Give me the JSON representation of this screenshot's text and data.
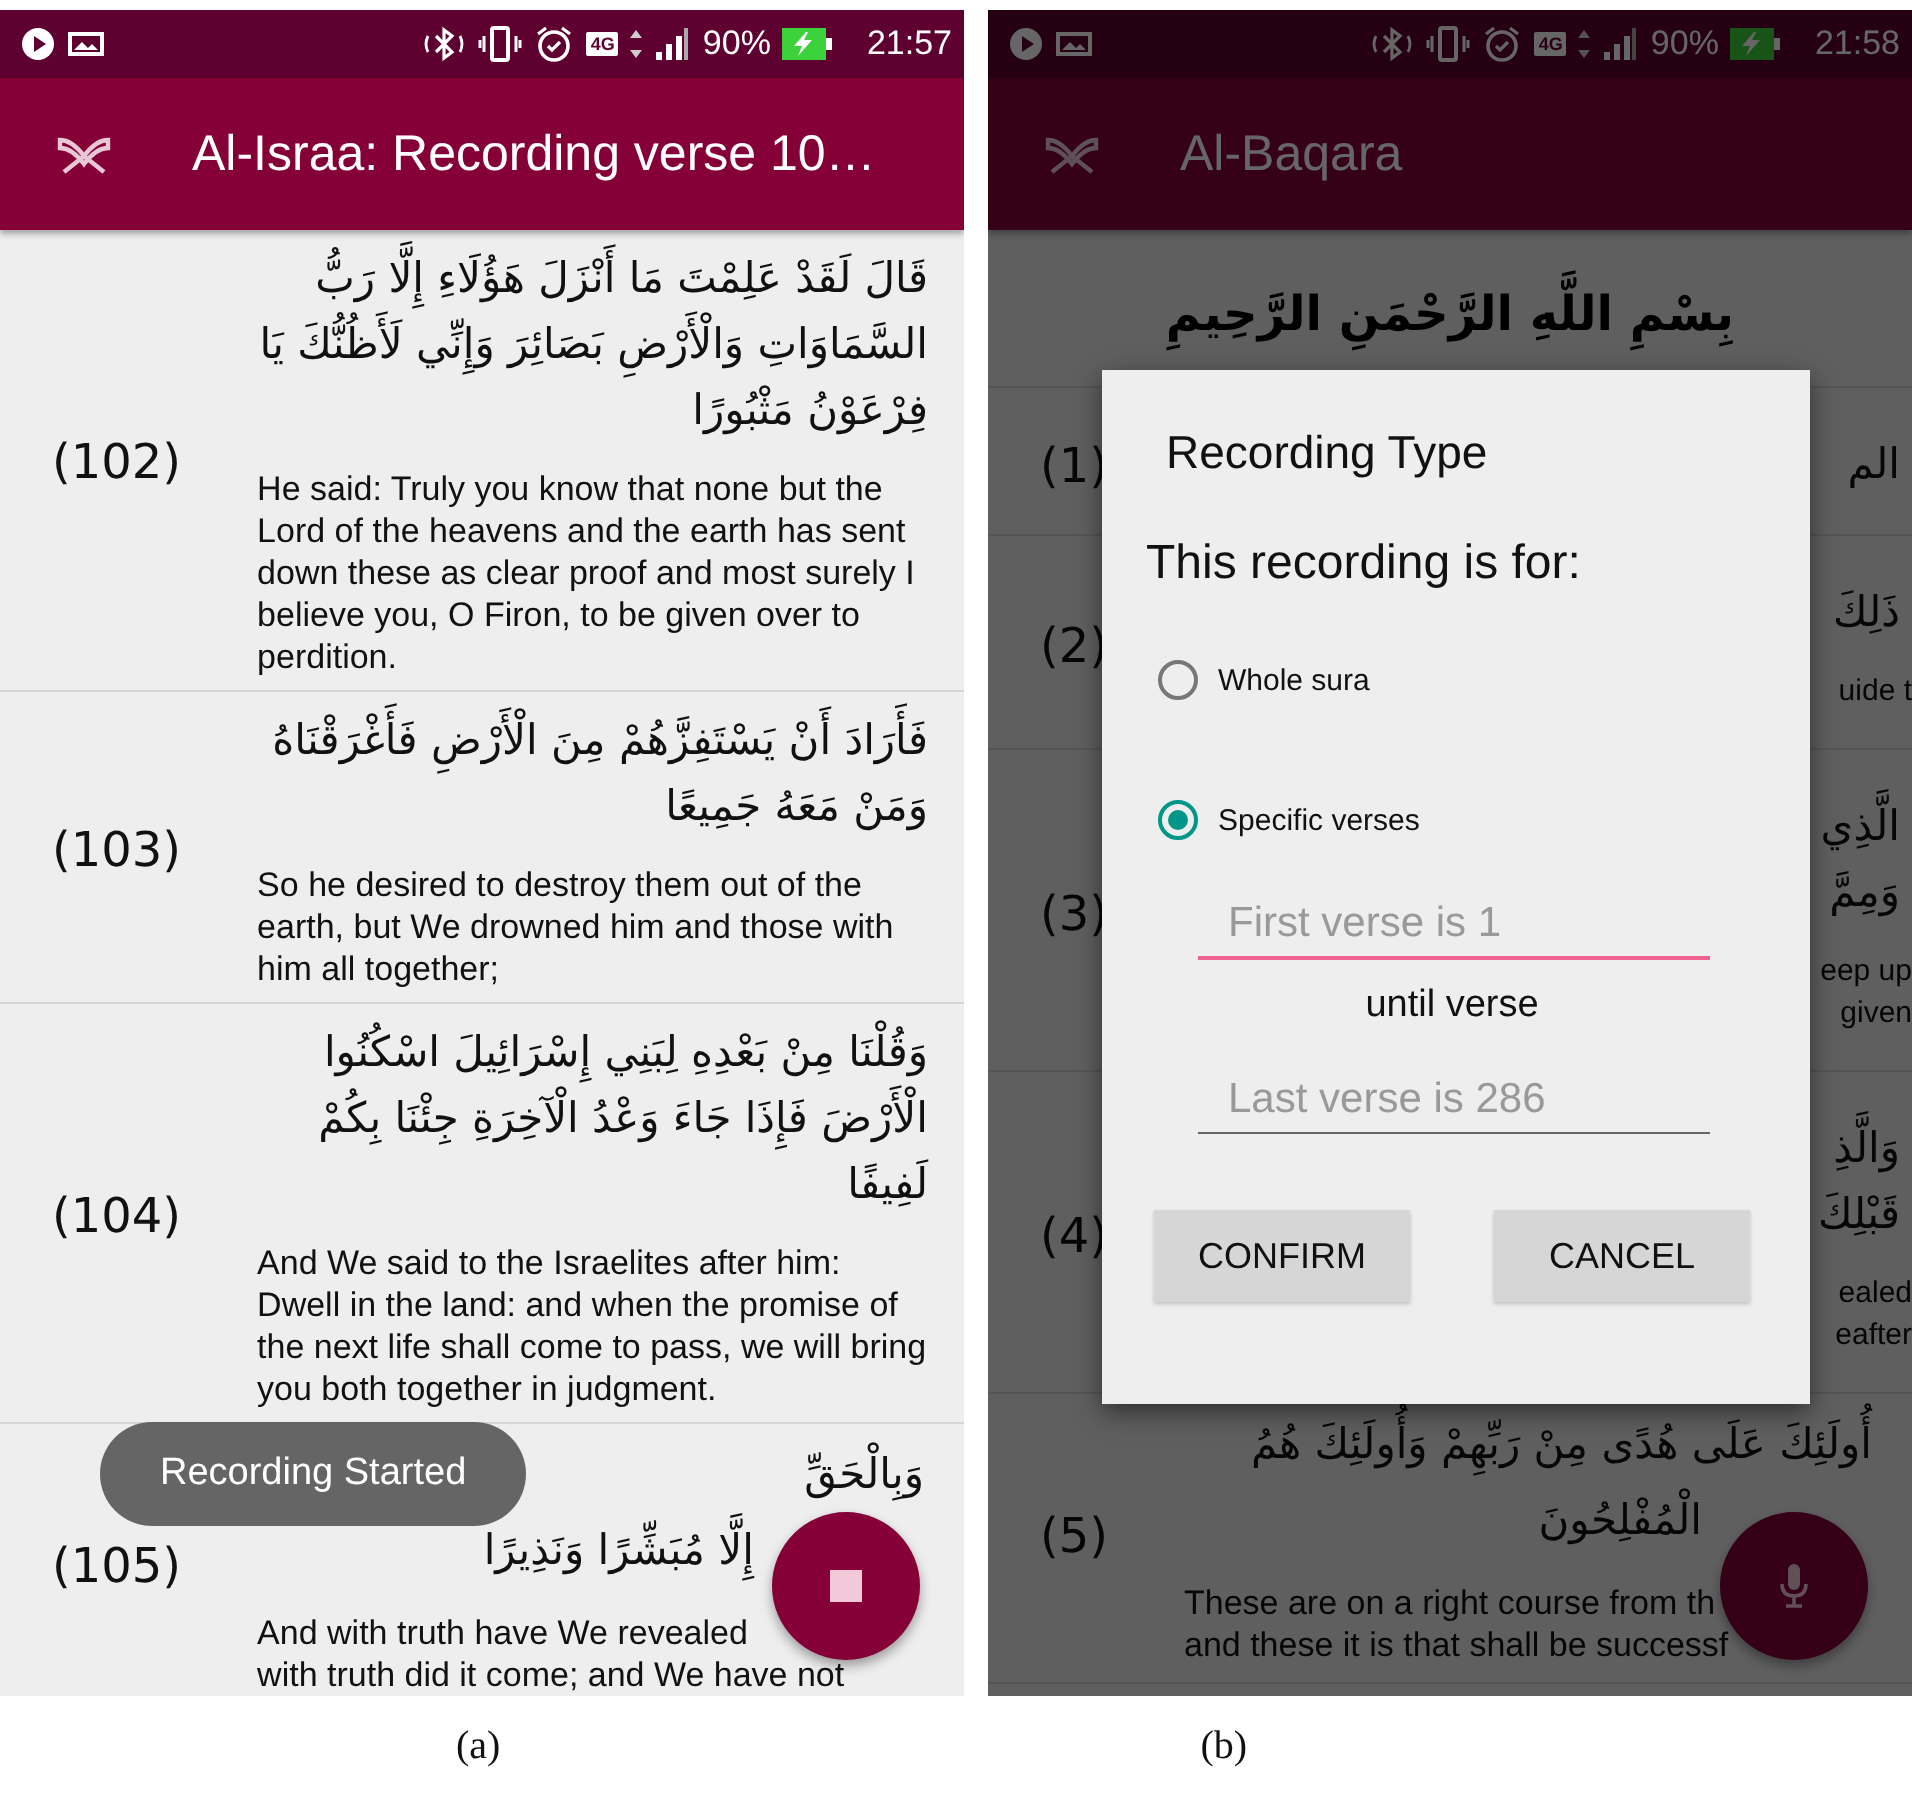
{
  "screens": [
    {
      "status_bar": {
        "network": "4G",
        "battery": "90%",
        "time": "21:57"
      },
      "app_bar": {
        "title": "Al-Israa: Recording verse 10…"
      },
      "verses": [
        {
          "kind": "verse",
          "number": "(102)",
          "arabic": "قَالَ لَقَدْ عَلِمْتَ مَا أَنْزَلَ هَؤُلَاءِ إِلَّا رَبُّ السَّمَاوَاتِ وَالْأَرْضِ بَصَائِرَ وَإِنِّي لَأَظُنُّكَ يَا فِرْعَوْنُ مَثْبُورًا",
          "translation": "He said: Truly you know that none but the Lord of the heavens and the earth has sent down these as clear proof and most surely I believe you, O Firon, to be given over to perdition."
        },
        {
          "kind": "verse",
          "number": "(103)",
          "arabic": "فَأَرَادَ أَنْ يَسْتَفِزَّهُمْ مِنَ الْأَرْضِ فَأَغْرَقْنَاهُ وَمَنْ مَعَهُ جَمِيعًا",
          "translation": "So he desired to destroy them out of the earth, but We drowned him and those with him all together;"
        },
        {
          "kind": "verse",
          "number": "(104)",
          "arabic": "وَقُلْنَا مِنْ بَعْدِهِ لِبَنِي إِسْرَائِيلَ اسْكُنُوا الْأَرْضَ فَإِذَا جَاءَ وَعْدُ الْآخِرَةِ جِئْنَا بِكُمْ لَفِيفًا",
          "translation": "And We said to the Israelites after him: Dwell in the land: and when the promise of the next life shall come to pass, we will bring you both together in judgment."
        },
        {
          "kind": "partial",
          "number": "(105)",
          "arabic": "وَبِالْحَقِّ\nإِلَّا مُبَشِّرًا وَنَذِيرًا",
          "translation": "And with truth have We revealed\nwith truth did it come; and We have not"
        }
      ],
      "toast": {
        "text": "Recording Started"
      },
      "fab": {
        "kind": "stop"
      }
    },
    {
      "status_bar": {
        "network": "4G",
        "battery": "90%",
        "time": "21:58"
      },
      "app_bar": {
        "title": "Al-Baqara"
      },
      "header": {
        "text": "بِسْمِ اللَّهِ الرَّحْمَنِ الرَّحِيمِ"
      },
      "verses": [
        {
          "kind": "fragment",
          "number": "(1)",
          "arabic": "الم"
        },
        {
          "kind": "fragment",
          "number": "(2)",
          "arabic": "ذَلِكَ",
          "translation": "uide t"
        },
        {
          "kind": "fragment",
          "number": "(3)",
          "arabic": "الَّذِي\nوَمِمَّ",
          "translation": "eep up\ngiven"
        },
        {
          "kind": "fragment",
          "number": "(4)",
          "arabic": "وَالَّذِ\nقَبْلِكَ",
          "translation": "ealed\neafter"
        },
        {
          "kind": "partial",
          "number": "(5)",
          "arabic": "أُولَئِكَ عَلَى هُدًى مِنْ رَبِّهِمْ وَأُولَئِكَ هُمُ\nالْمُفْلِحُونَ",
          "translation": "These are on a right course from th\nand these it is that shall be successf"
        }
      ],
      "dialog": {
        "title": "Recording Type",
        "prompt": "This recording is for:",
        "options": [
          {
            "label": "Whole sura",
            "selected": false
          },
          {
            "label": "Specific verses",
            "selected": true
          }
        ],
        "first_field": {
          "placeholder": "First verse is 1",
          "focused": true
        },
        "separator": "until verse",
        "last_field": {
          "placeholder": "Last verse is 286",
          "focused": false
        },
        "buttons": [
          "CONFIRM",
          "CANCEL"
        ]
      },
      "fab": {
        "kind": "mic"
      }
    }
  ],
  "captions": [
    "(a)",
    "(b)"
  ]
}
